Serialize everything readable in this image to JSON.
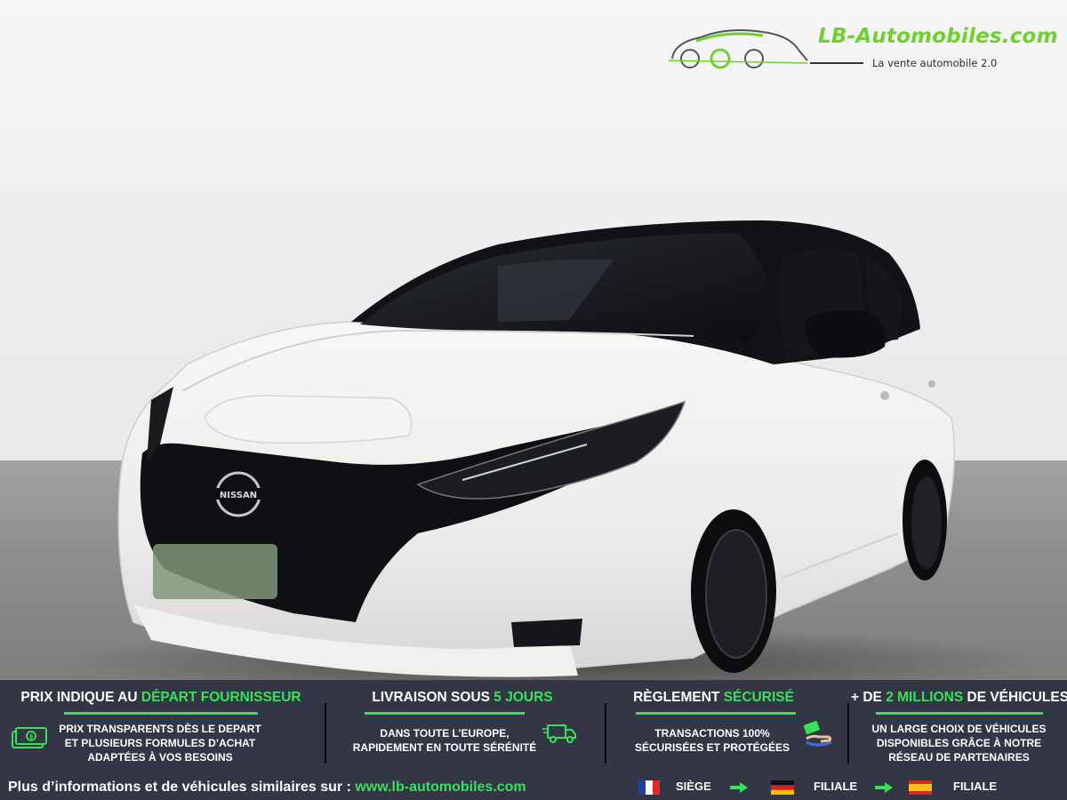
{
  "logo": {
    "name": "LB-Automobiles.com",
    "tagline": "La vente automobile 2.0"
  },
  "photo": {
    "car_badge": "NISSAN"
  },
  "banner": {
    "columns": [
      {
        "title_pre": "PRIX INDIQUE AU ",
        "title_hl": "DÉPART FOURNISSEUR",
        "title_post": "",
        "lines": [
          "PRIX TRANSPARENTS DÈS LE DEPART",
          "ET PLUSIEURS FORMULES D’ACHAT",
          "ADAPTÉES À VOS BESOINS"
        ],
        "icon": "money-icon"
      },
      {
        "title_pre": "LIVRAISON SOUS ",
        "title_hl": "5 JOURS",
        "title_post": "",
        "lines": [
          "DANS TOUTE L’EUROPE,",
          "RAPIDEMENT EN TOUTE SÉRÉNITÉ"
        ],
        "icon": "delivery-truck-icon"
      },
      {
        "title_pre": "RÈGLEMENT ",
        "title_hl": "SÉCURISÉ",
        "title_post": "",
        "lines": [
          "TRANSACTIONS 100%",
          "SÉCURISÉES ET PROTÉGÉES"
        ],
        "icon": "payment-hand-icon"
      },
      {
        "title_pre": "+ DE ",
        "title_hl": "2 MILLIONS",
        "title_post": " DE VÉHICULES",
        "lines": [
          "UN LARGE CHOIX DE VÉHICULES",
          "DISPONIBLES GRÂCE À NOTRE",
          "RÉSEAU DE PARTENAIRES"
        ],
        "icon": ""
      }
    ],
    "footer_text": "Plus d’informations et de véhicules similaires sur : ",
    "footer_url": "www.lb-automobiles.com",
    "locations": [
      {
        "flag": "france-flag",
        "label": "SIÈGE"
      },
      {
        "flag": "germany-flag",
        "label": "FILIALE"
      },
      {
        "flag": "spain-flag",
        "label": "FILIALE"
      }
    ]
  },
  "colors": {
    "accent_green": "#39e05a",
    "banner_bg": "#333745",
    "logo_green": "#6fd12e"
  }
}
